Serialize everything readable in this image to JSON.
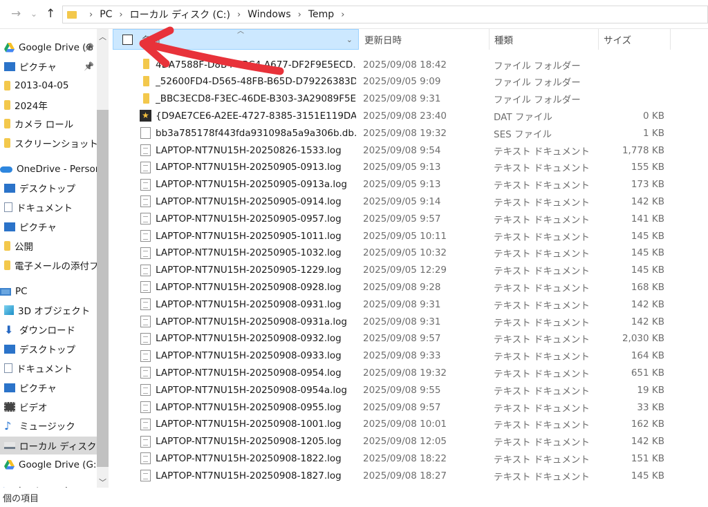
{
  "address": {
    "crumbs": [
      "PC",
      "ローカル ディスク (C:)",
      "Windows",
      "Temp"
    ]
  },
  "sidebar": {
    "items": [
      {
        "label": "Google Drive (G",
        "icon": "google-drive-icon",
        "pinned": true
      },
      {
        "label": "ピクチャ",
        "icon": "pictures-icon",
        "pinned": true
      },
      {
        "label": "2013-04-05",
        "icon": "folder-icon"
      },
      {
        "label": "2024年",
        "icon": "folder-icon"
      },
      {
        "label": "カメラ ロール",
        "icon": "folder-icon"
      },
      {
        "label": "スクリーンショット",
        "icon": "folder-icon"
      },
      {
        "label": "OneDrive - Persona",
        "icon": "onedrive-cloud-icon"
      },
      {
        "label": "デスクトップ",
        "icon": "desktop-icon"
      },
      {
        "label": "ドキュメント",
        "icon": "documents-icon"
      },
      {
        "label": "ピクチャ",
        "icon": "pictures-icon"
      },
      {
        "label": "公開",
        "icon": "folder-icon"
      },
      {
        "label": "電子メールの添付フ",
        "icon": "folder-icon"
      },
      {
        "label": "PC",
        "icon": "pc-icon"
      },
      {
        "label": "3D オブジェクト",
        "icon": "3d-objects-icon"
      },
      {
        "label": "ダウンロード",
        "icon": "download-icon"
      },
      {
        "label": "デスクトップ",
        "icon": "desktop-icon"
      },
      {
        "label": "ドキュメント",
        "icon": "documents-icon"
      },
      {
        "label": "ピクチャ",
        "icon": "pictures-icon"
      },
      {
        "label": "ビデオ",
        "icon": "video-icon"
      },
      {
        "label": "ミュージック",
        "icon": "music-icon"
      },
      {
        "label": "ローカル ディスク (C:)",
        "icon": "local-disk-icon",
        "selected": true
      },
      {
        "label": "Google Drive (G:)",
        "icon": "google-drive-icon"
      },
      {
        "label": "ネットワーク",
        "icon": "network-icon"
      }
    ]
  },
  "columns": {
    "name": "名前",
    "date": "更新日時",
    "type": "種類",
    "size": "サイズ"
  },
  "files": [
    {
      "name": "4DA7588F-D8B4-4BC4-A677-DF2F9E5ECD...",
      "date": "2025/09/08 18:42",
      "type": "ファイル フォルダー",
      "size": "",
      "icon": "folder"
    },
    {
      "name": "_52600FD4-D565-48FB-B65D-D79226383D...",
      "date": "2025/09/05 9:09",
      "type": "ファイル フォルダー",
      "size": "",
      "icon": "folder"
    },
    {
      "name": "_BBC3ECD8-F3EC-46DE-B303-3A29089F5EE9",
      "date": "2025/09/08 9:31",
      "type": "ファイル フォルダー",
      "size": "",
      "icon": "folder"
    },
    {
      "name": "{D9AE7CE6-A2EE-4727-8385-3151E119DAD...",
      "date": "2025/09/08 23:40",
      "type": "DAT ファイル",
      "size": "0 KB",
      "icon": "dat"
    },
    {
      "name": "bb3a785178f443fda931098a5a9a306b.db.ses",
      "date": "2025/09/08 19:32",
      "type": "SES ファイル",
      "size": "1 KB",
      "icon": "plain"
    },
    {
      "name": "LAPTOP-NT7NU15H-20250826-1533.log",
      "date": "2025/09/08 9:54",
      "type": "テキスト ドキュメント",
      "size": "1,778 KB",
      "icon": "doc"
    },
    {
      "name": "LAPTOP-NT7NU15H-20250905-0913.log",
      "date": "2025/09/05 9:13",
      "type": "テキスト ドキュメント",
      "size": "155 KB",
      "icon": "doc"
    },
    {
      "name": "LAPTOP-NT7NU15H-20250905-0913a.log",
      "date": "2025/09/05 9:13",
      "type": "テキスト ドキュメント",
      "size": "173 KB",
      "icon": "doc"
    },
    {
      "name": "LAPTOP-NT7NU15H-20250905-0914.log",
      "date": "2025/09/05 9:14",
      "type": "テキスト ドキュメント",
      "size": "142 KB",
      "icon": "doc"
    },
    {
      "name": "LAPTOP-NT7NU15H-20250905-0957.log",
      "date": "2025/09/05 9:57",
      "type": "テキスト ドキュメント",
      "size": "141 KB",
      "icon": "doc"
    },
    {
      "name": "LAPTOP-NT7NU15H-20250905-1011.log",
      "date": "2025/09/05 10:11",
      "type": "テキスト ドキュメント",
      "size": "145 KB",
      "icon": "doc"
    },
    {
      "name": "LAPTOP-NT7NU15H-20250905-1032.log",
      "date": "2025/09/05 10:32",
      "type": "テキスト ドキュメント",
      "size": "145 KB",
      "icon": "doc"
    },
    {
      "name": "LAPTOP-NT7NU15H-20250905-1229.log",
      "date": "2025/09/05 12:29",
      "type": "テキスト ドキュメント",
      "size": "145 KB",
      "icon": "doc"
    },
    {
      "name": "LAPTOP-NT7NU15H-20250908-0928.log",
      "date": "2025/09/08 9:28",
      "type": "テキスト ドキュメント",
      "size": "168 KB",
      "icon": "doc"
    },
    {
      "name": "LAPTOP-NT7NU15H-20250908-0931.log",
      "date": "2025/09/08 9:31",
      "type": "テキスト ドキュメント",
      "size": "142 KB",
      "icon": "doc"
    },
    {
      "name": "LAPTOP-NT7NU15H-20250908-0931a.log",
      "date": "2025/09/08 9:31",
      "type": "テキスト ドキュメント",
      "size": "142 KB",
      "icon": "doc"
    },
    {
      "name": "LAPTOP-NT7NU15H-20250908-0932.log",
      "date": "2025/09/08 9:57",
      "type": "テキスト ドキュメント",
      "size": "2,030 KB",
      "icon": "doc"
    },
    {
      "name": "LAPTOP-NT7NU15H-20250908-0933.log",
      "date": "2025/09/08 9:33",
      "type": "テキスト ドキュメント",
      "size": "164 KB",
      "icon": "doc"
    },
    {
      "name": "LAPTOP-NT7NU15H-20250908-0954.log",
      "date": "2025/09/08 19:32",
      "type": "テキスト ドキュメント",
      "size": "651 KB",
      "icon": "doc"
    },
    {
      "name": "LAPTOP-NT7NU15H-20250908-0954a.log",
      "date": "2025/09/08 9:55",
      "type": "テキスト ドキュメント",
      "size": "19 KB",
      "icon": "doc"
    },
    {
      "name": "LAPTOP-NT7NU15H-20250908-0955.log",
      "date": "2025/09/08 9:57",
      "type": "テキスト ドキュメント",
      "size": "33 KB",
      "icon": "doc"
    },
    {
      "name": "LAPTOP-NT7NU15H-20250908-1001.log",
      "date": "2025/09/08 10:01",
      "type": "テキスト ドキュメント",
      "size": "162 KB",
      "icon": "doc"
    },
    {
      "name": "LAPTOP-NT7NU15H-20250908-1205.log",
      "date": "2025/09/08 12:05",
      "type": "テキスト ドキュメント",
      "size": "142 KB",
      "icon": "doc"
    },
    {
      "name": "LAPTOP-NT7NU15H-20250908-1822.log",
      "date": "2025/09/08 18:22",
      "type": "テキスト ドキュメント",
      "size": "151 KB",
      "icon": "doc"
    },
    {
      "name": "LAPTOP-NT7NU15H-20250908-1827.log",
      "date": "2025/09/08 18:27",
      "type": "テキスト ドキュメント",
      "size": "145 KB",
      "icon": "doc"
    }
  ],
  "status": {
    "text": "個の項目"
  },
  "colors": {
    "header_selected_bg": "#cce8ff",
    "folder": "#f3c84c",
    "annotation_arrow": "#e8323a"
  }
}
